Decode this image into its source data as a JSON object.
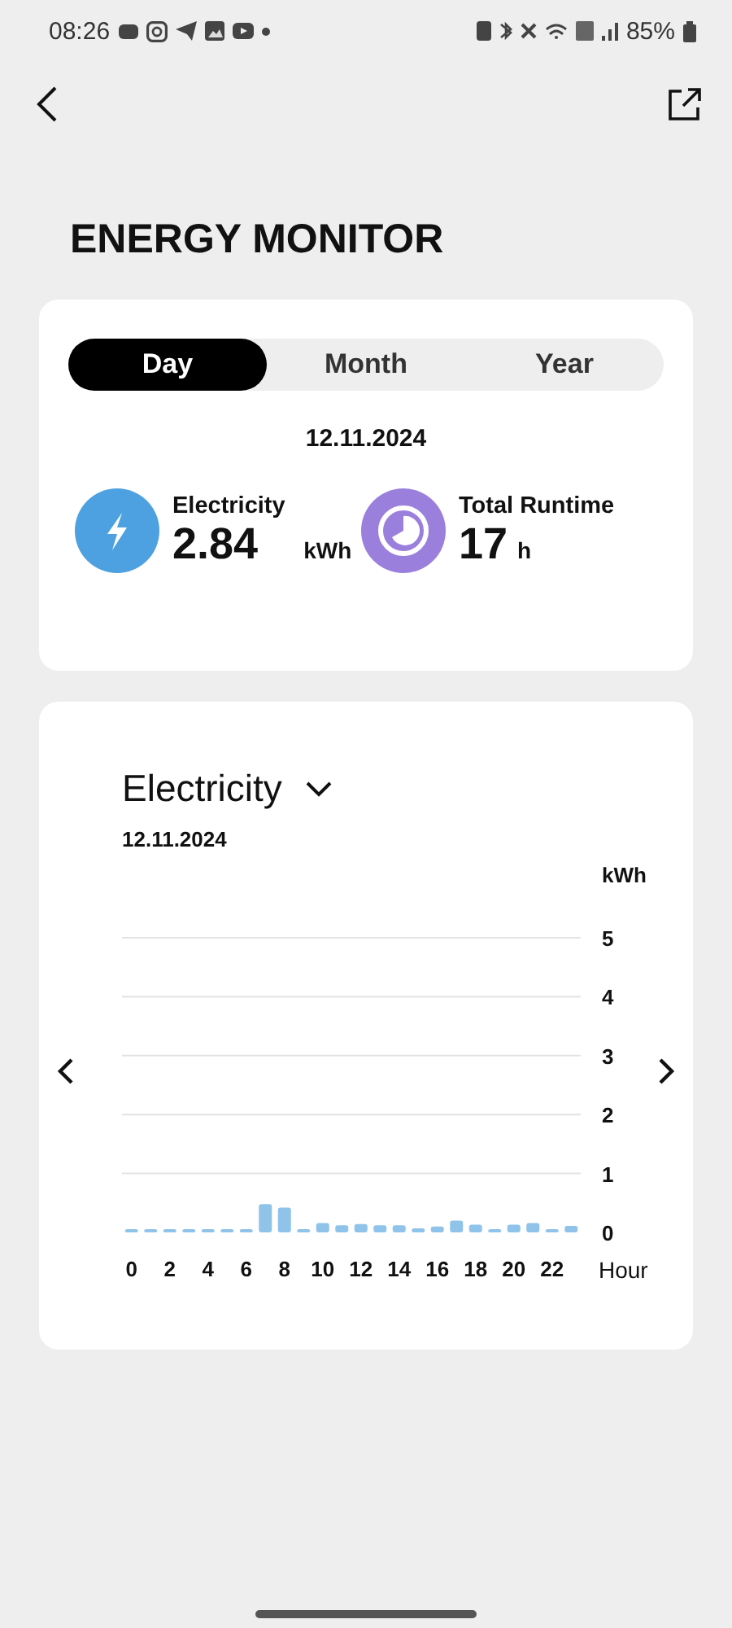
{
  "status_bar": {
    "time": "08:26",
    "battery": "85%"
  },
  "title": "ENERGY MONITOR",
  "tabs": [
    {
      "label": "Day",
      "selected": true
    },
    {
      "label": "Month",
      "selected": false
    },
    {
      "label": "Year",
      "selected": false
    }
  ],
  "summary": {
    "date": "12.11.2024",
    "stats": [
      {
        "kind": "electricity",
        "label": "Electricity",
        "value": "2.84",
        "unit": "kWh"
      },
      {
        "kind": "runtime",
        "label": "Total Runtime",
        "value": "17",
        "unit": "h"
      }
    ]
  },
  "chart_panel": {
    "selector": "Electricity",
    "date": "12.11.2024",
    "chart_data": {
      "type": "bar",
      "xlabel": "Hour",
      "ylabel": "kWh",
      "x": [
        0,
        1,
        2,
        3,
        4,
        5,
        6,
        7,
        8,
        9,
        10,
        11,
        12,
        13,
        14,
        15,
        16,
        17,
        18,
        19,
        20,
        21,
        22,
        23
      ],
      "grid": true,
      "xlim": [
        -0.5,
        23.5
      ],
      "series": [
        {
          "color": "#8fc3ea",
          "values": [
            0.05,
            0,
            0,
            0,
            0,
            0,
            0,
            0.48,
            0.42,
            0.03,
            0.16,
            0.12,
            0.14,
            0.12,
            0.12,
            0.07,
            0.1,
            0.2,
            0.13,
            0.03,
            0.13,
            0.16,
            0.03,
            0.11
          ]
        }
      ],
      "ylim": [
        0,
        5
      ],
      "yticks": [
        0,
        1,
        2,
        3,
        4,
        5
      ],
      "xticks": [
        0,
        2,
        4,
        6,
        8,
        10,
        12,
        14,
        16,
        18,
        20,
        22
      ]
    }
  }
}
